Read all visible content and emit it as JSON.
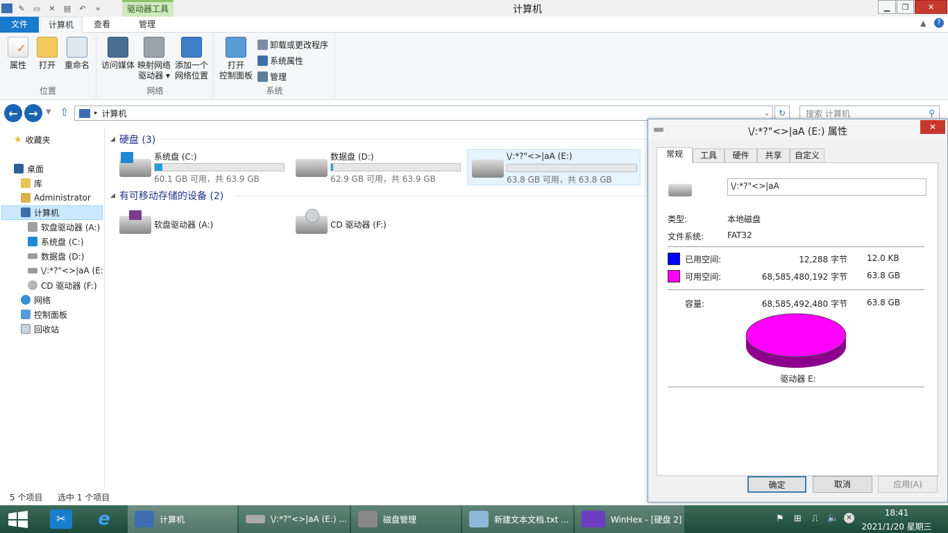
{
  "window": {
    "title": "计算机",
    "context_tab": "驱动器工具"
  },
  "tabs": {
    "file": "文件",
    "computer": "计算机",
    "view": "查看",
    "manage": "管理"
  },
  "ribbon": {
    "location": {
      "label": "位置",
      "properties": "属性",
      "open": "打开",
      "rename": "重命名"
    },
    "network": {
      "label": "网络",
      "media_line1": "访问媒体",
      "map_line1": "映射网络",
      "map_line2": "驱动器 ▾",
      "add_line1": "添加一个",
      "add_line2": "网络位置"
    },
    "system": {
      "label": "系统",
      "cp_line1": "打开",
      "cp_line2": "控制面板",
      "uninstall": "卸载或更改程序",
      "sysprops": "系统属性",
      "manage": "管理"
    }
  },
  "address": {
    "path": "计算机",
    "search_placeholder": "搜索 计算机"
  },
  "nav": {
    "favorites": "收藏夹",
    "desktop": "桌面",
    "libraries": "库",
    "administrator": "Administrator",
    "computer": "计算机",
    "floppy": "软盘驱动器 (A:)",
    "system": "系统盘 (C:)",
    "data": "数据盘 (D:)",
    "edrive": "\\/:*?\"<>|aA (E:)",
    "cd": "CD 驱动器 (F:)",
    "network": "网络",
    "control_panel": "控制面板",
    "recycle": "回收站"
  },
  "content": {
    "hdd_group": "硬盘 (3)",
    "removable_group": "有可移动存储的设备 (2)",
    "drives": [
      {
        "name": "系统盘 (C:)",
        "info": "60.1 GB 可用，共 63.9 GB",
        "used_fraction": 0.06
      },
      {
        "name": "数据盘 (D:)",
        "info": "62.9 GB 可用，共 63.9 GB",
        "used_fraction": 0.016
      },
      {
        "name": "\\/:*?\"<>|aA (E:)",
        "info": "63.8 GB 可用，共 63.8 GB",
        "used_fraction": 0.0
      }
    ],
    "removable": [
      {
        "name": "软盘驱动器 (A:)"
      },
      {
        "name": "CD 驱动器 (F:)"
      }
    ]
  },
  "status": {
    "items": "5 个项目",
    "selected": "选中 1 个项目"
  },
  "dialog": {
    "title": "\\/:*?\"<>|aA (E:) 属性",
    "tabs": [
      "常规",
      "工具",
      "硬件",
      "共享",
      "自定义"
    ],
    "volume_label": "\\/:*?\"<>|aA",
    "type_label": "类型:",
    "type_value": "本地磁盘",
    "fs_label": "文件系统:",
    "fs_value": "FAT32",
    "used_label": "已用空间:",
    "used_bytes": "12,288 字节",
    "used_size": "12.0 KB",
    "free_label": "可用空间:",
    "free_bytes": "68,585,480,192 字节",
    "free_size": "63.8 GB",
    "cap_label": "容量:",
    "cap_bytes": "68,585,492,480 字节",
    "cap_size": "63.8 GB",
    "drive_label": "驱动器 E:",
    "ok": "确定",
    "cancel": "取消",
    "apply": "应用(A)",
    "used_color": "#0000ff",
    "free_color": "#ff00ff"
  },
  "taskbar": {
    "items": [
      "计算机",
      "\\/:*?\"<>|aA (E:) ...",
      "磁盘管理",
      "新建文本文档.txt ...",
      "WinHex - [硬盘 2]"
    ],
    "time": "18:41",
    "date": "2021/1/20 星期三"
  }
}
